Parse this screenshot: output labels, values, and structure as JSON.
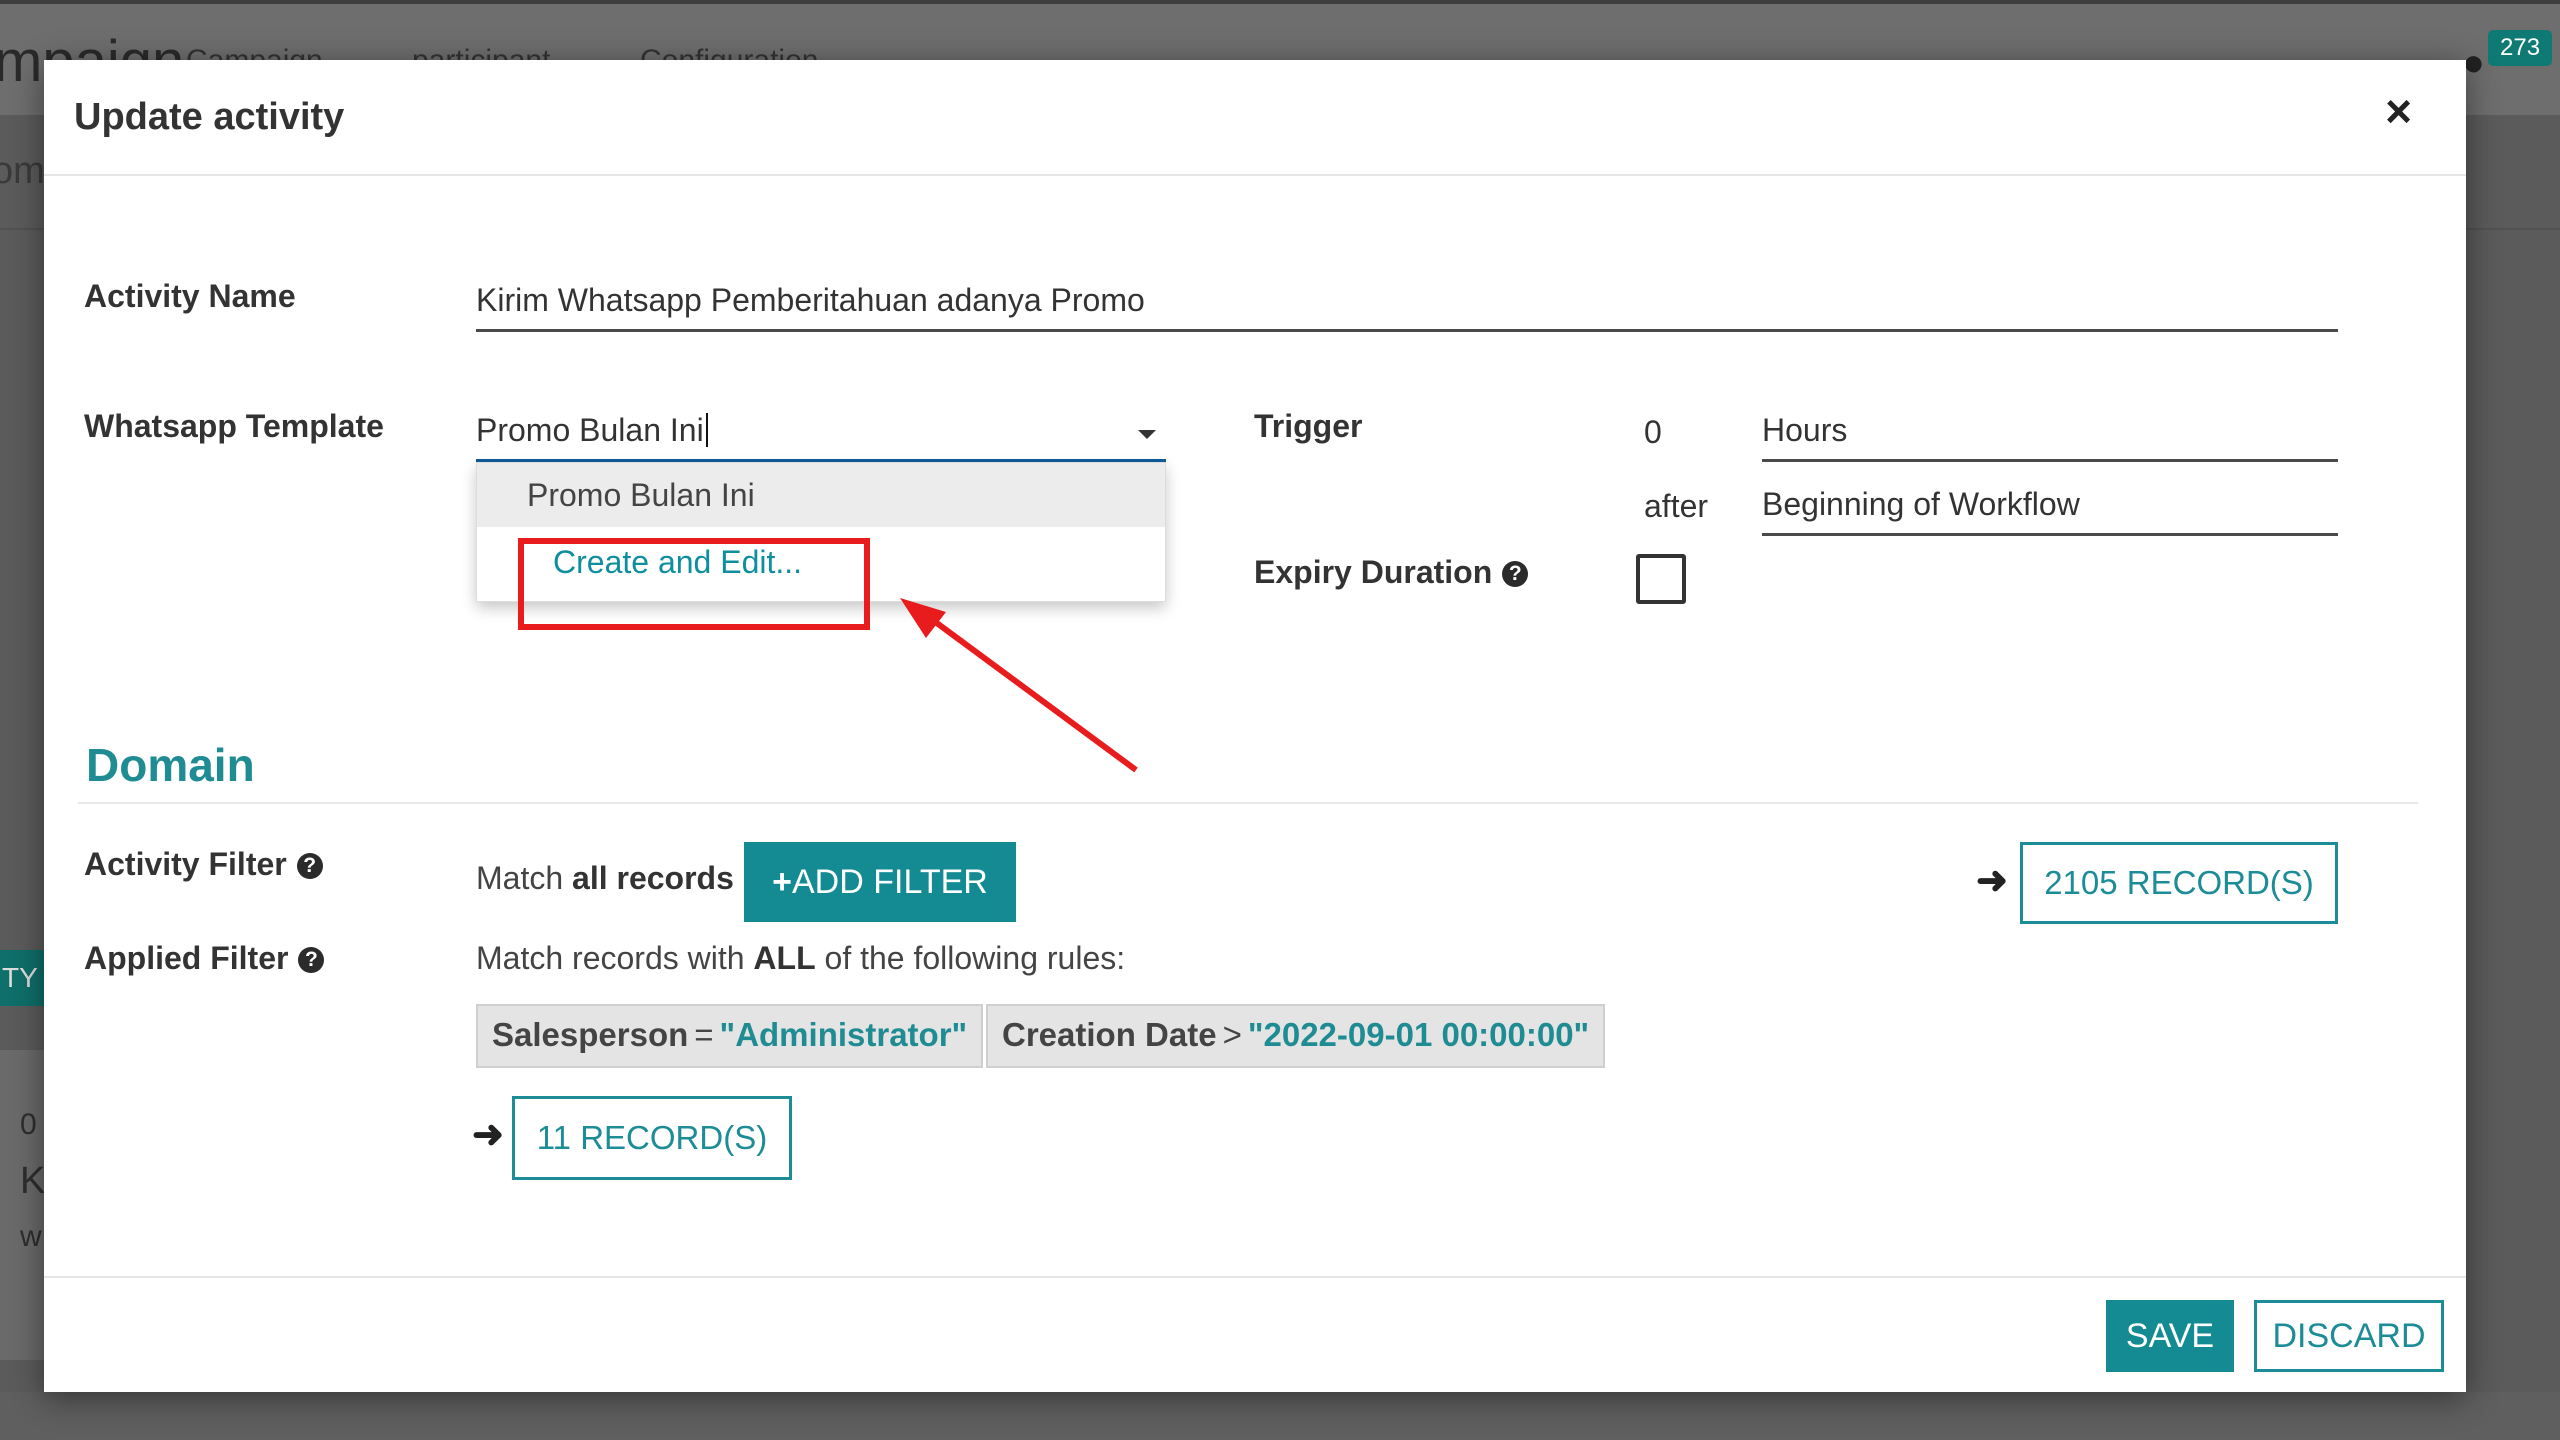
{
  "background": {
    "app_title": "mpaign",
    "menu": [
      "Campaign",
      "participant",
      "Configuration"
    ],
    "notification_count": "273",
    "subtitle": "om",
    "side_button": "TY",
    "card_lines": [
      "0",
      "K",
      "w"
    ]
  },
  "modal": {
    "title": "Update activity",
    "close_symbol": "×",
    "activity_name": {
      "label": "Activity Name",
      "value": "Kirim Whatsapp Pemberitahuan adanya Promo"
    },
    "whatsapp_template": {
      "label": "Whatsapp Template",
      "value": "Promo Bulan Ini",
      "dropdown": {
        "options": [
          "Promo Bulan Ini"
        ],
        "create_and_edit": "Create and Edit..."
      }
    },
    "trigger": {
      "label": "Trigger",
      "interval_number": "0",
      "interval_unit": "Hours",
      "after_label": "after",
      "type": "Beginning of Workflow"
    },
    "expiry_duration": {
      "label": "Expiry Duration",
      "checked": false
    },
    "domain": {
      "title": "Domain",
      "activity_filter": {
        "label": "Activity Filter",
        "match_prefix": "Match",
        "match_bold": "all records",
        "add_filter_plus": "+",
        "add_filter_label": "ADD FILTER",
        "records_button": "2105 RECORD(S)"
      },
      "applied_filter": {
        "label": "Applied Filter",
        "rules_prefix": "Match records with",
        "rules_bold": "ALL",
        "rules_suffix": "of the following rules:",
        "chips": [
          {
            "field": "Salesperson",
            "op": "=",
            "value": "\"Administrator\""
          },
          {
            "field": "Creation Date",
            "op": ">",
            "value": "\"2022-09-01 00:00:00\""
          }
        ],
        "records_button": "11 RECORD(S)"
      }
    },
    "footer": {
      "save": "SAVE",
      "discard": "DISCARD"
    }
  },
  "annotation": {
    "highlight_color": "#e81c1c"
  },
  "colors": {
    "accent": "#148b93",
    "link": "#0f8ea0"
  }
}
